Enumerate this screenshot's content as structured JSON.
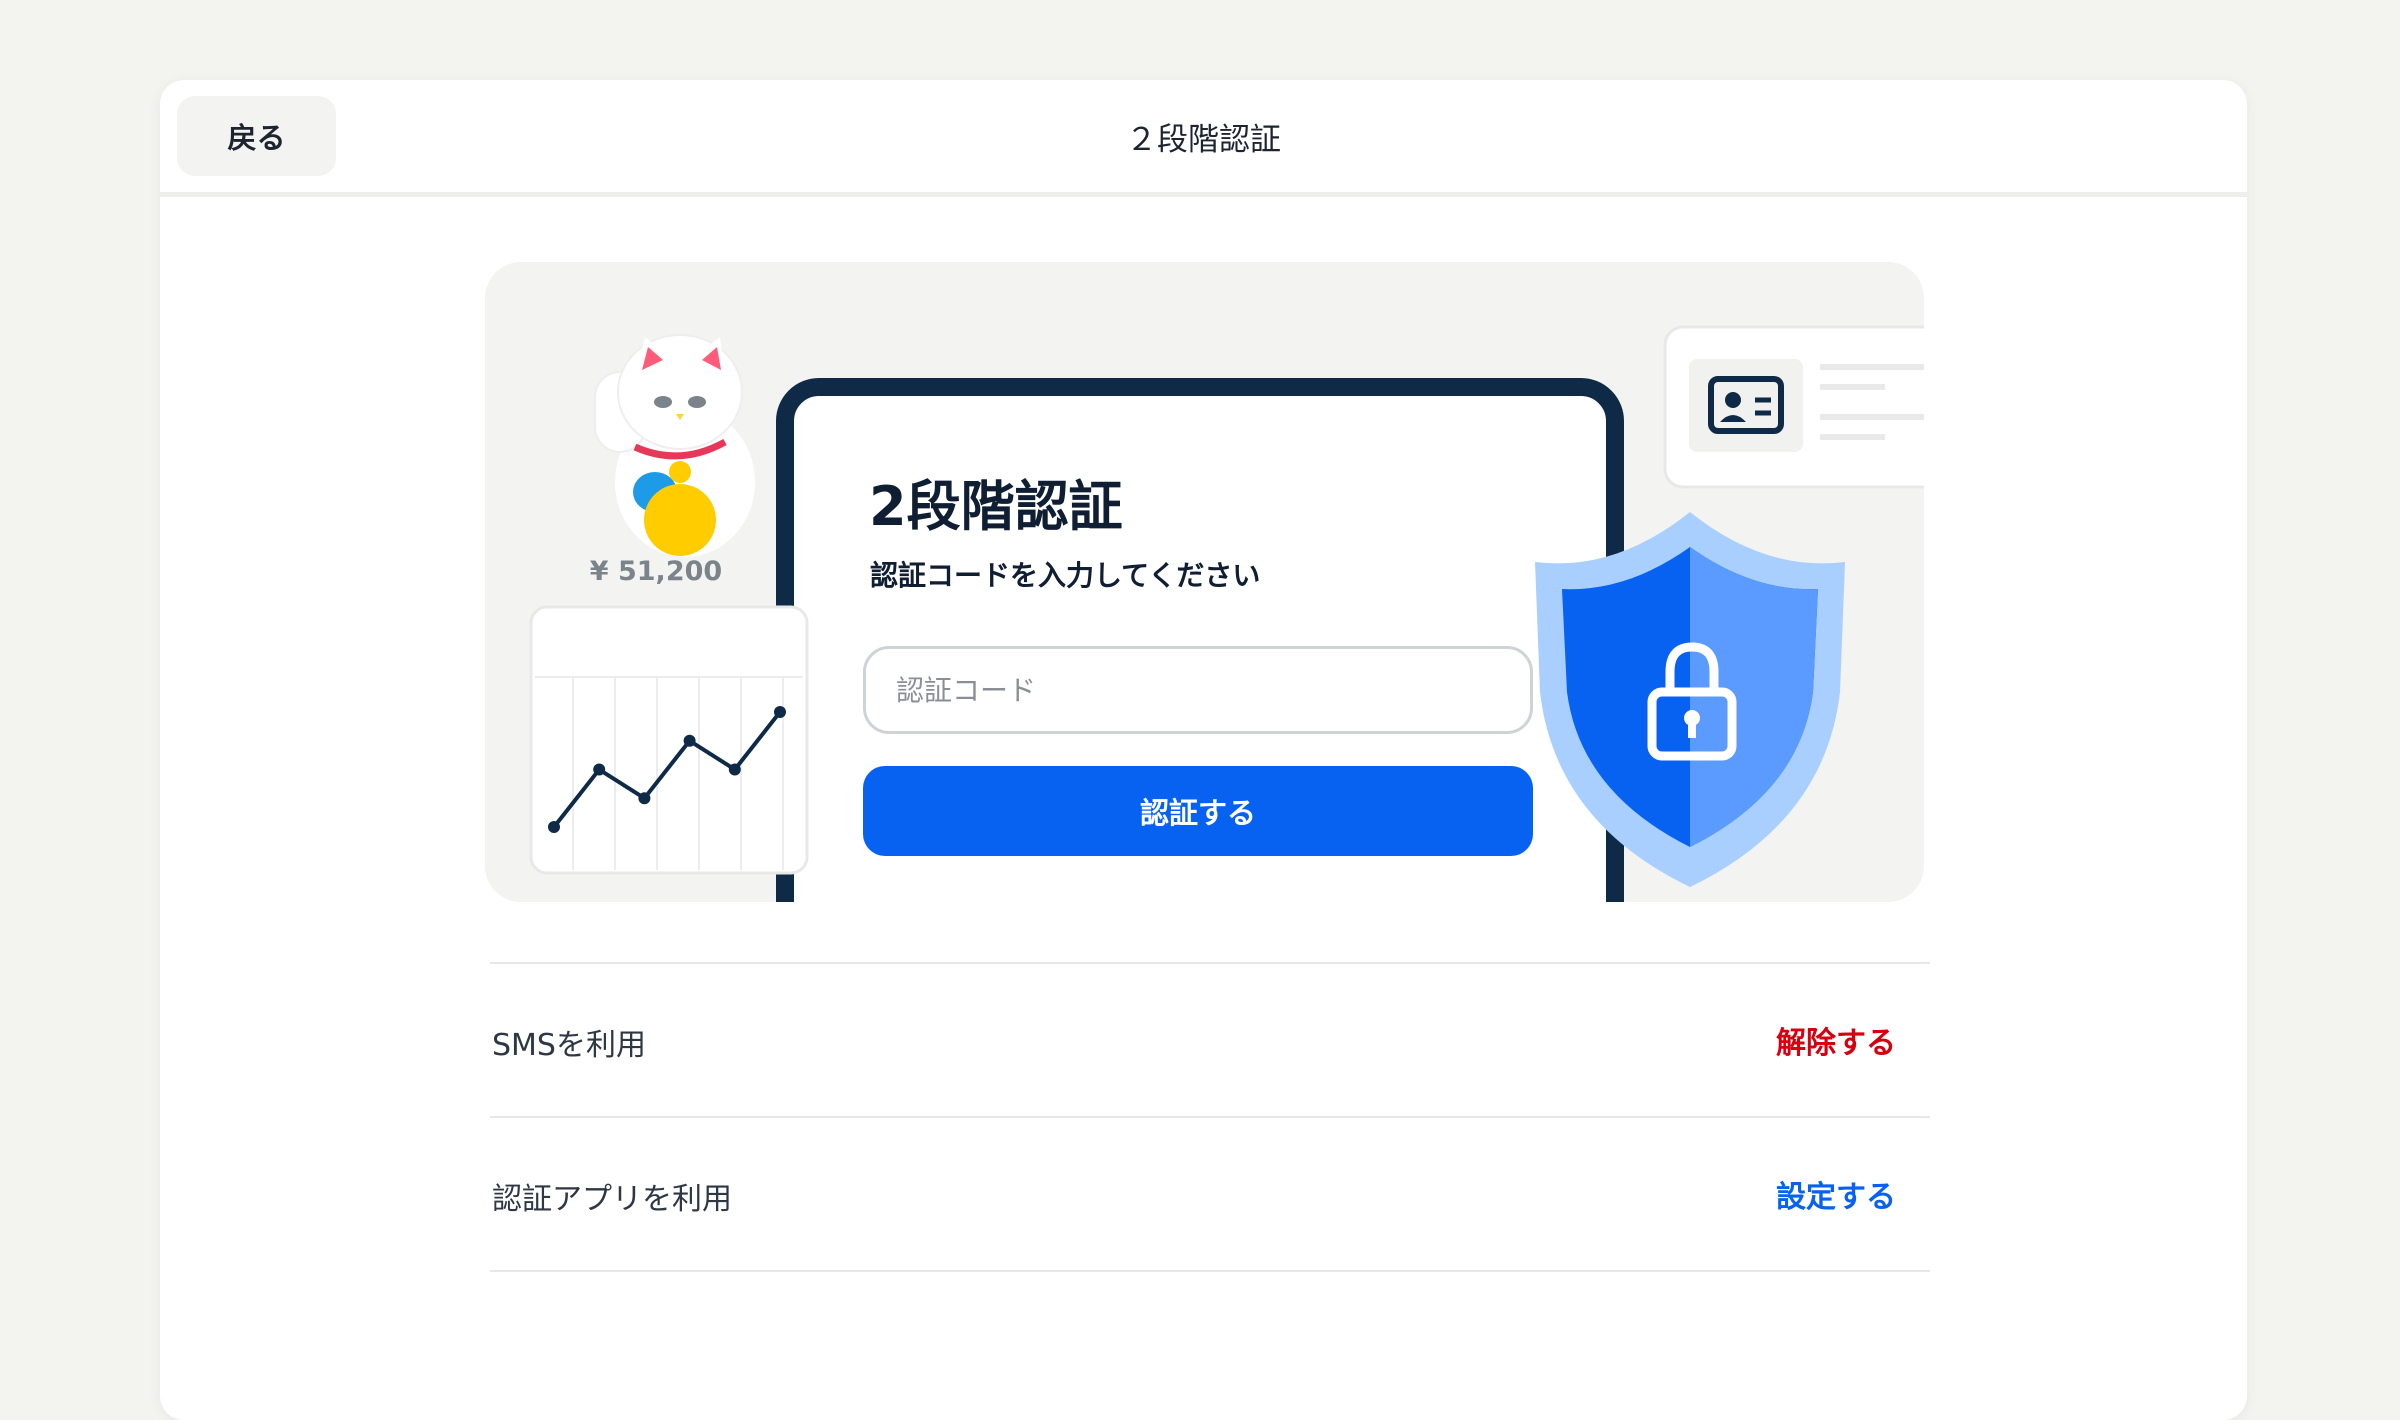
{
  "header": {
    "back_label": "戻る",
    "title": "２段階認証"
  },
  "hero": {
    "tablet_title": "2段階認証",
    "tablet_subtitle": "認証コードを入力してください",
    "code_placeholder": "認証コード",
    "code_value": "",
    "verify_label": "認証する",
    "price_label": "¥ 51,200",
    "mini_chart_values": [
      1,
      3,
      2,
      4,
      3,
      5
    ],
    "icons": [
      "maneki-neko-icon",
      "id-card-icon",
      "shield-lock-icon",
      "line-chart-icon"
    ]
  },
  "options": [
    {
      "label": "SMSを利用",
      "action": "解除する",
      "action_color": "#d7000f"
    },
    {
      "label": "認証アプリを利用",
      "action": "設定する",
      "action_color": "#0762f2"
    }
  ],
  "colors": {
    "primary": "#0762f2",
    "danger": "#d7000f",
    "navy": "#0f2a47",
    "background": "#f3f3f0"
  }
}
